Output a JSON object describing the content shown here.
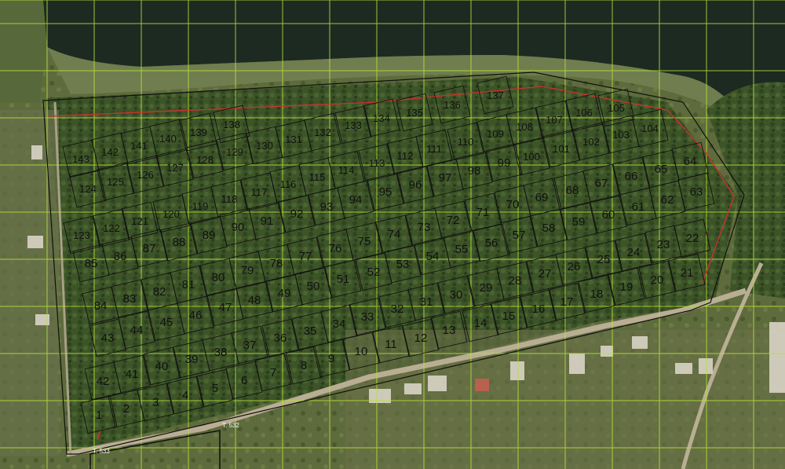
{
  "map": {
    "colors": {
      "water": "#1b2a22",
      "vegetation": "#3f5a2a",
      "grid": "#b9e236",
      "plot_outline": "#111111",
      "boundary_red": "#d0312d",
      "road": "#b8ae95"
    },
    "survey_markers": [
      "T. 532",
      "T. 533"
    ],
    "plots": [
      "1",
      "2",
      "3",
      "4",
      "5",
      "6",
      "7",
      "8",
      "9",
      "10",
      "11",
      "12",
      "13",
      "14",
      "15",
      "16",
      "17",
      "18",
      "19",
      "20",
      "21",
      "22",
      "23",
      "24",
      "25",
      "26",
      "27",
      "28",
      "29",
      "30",
      "31",
      "32",
      "33",
      "34",
      "35",
      "36",
      "37",
      "38",
      "39",
      "40",
      "41",
      "42",
      "43",
      "44",
      "45",
      "46",
      "47",
      "48",
      "49",
      "50",
      "51",
      "52",
      "53",
      "54",
      "55",
      "56",
      "57",
      "58",
      "59",
      "60",
      "61",
      "62",
      "63",
      "64",
      "65",
      "66",
      "67",
      "68",
      "69",
      "70",
      "71",
      "72",
      "73",
      "74",
      "75",
      "76",
      "77",
      "78",
      "79",
      "80",
      "81",
      "82",
      "83",
      "84",
      "85",
      "86",
      "87",
      "88",
      "89",
      "90",
      "91",
      "92",
      "93",
      "94",
      "95",
      "96",
      "97",
      "98",
      "99",
      "100",
      "101",
      "102",
      "103",
      "104",
      "105",
      "106",
      "107",
      "108",
      "109",
      "110",
      "111",
      "112",
      "113",
      "114",
      "115",
      "116",
      "117",
      "118",
      "119",
      "120",
      "121",
      "122",
      "123",
      "124",
      "125",
      "126",
      "127",
      "128",
      "129",
      "130",
      "131",
      "132",
      "133",
      "134",
      "135",
      "136",
      "137",
      "138",
      "139",
      "140",
      "141",
      "142",
      "143"
    ]
  }
}
